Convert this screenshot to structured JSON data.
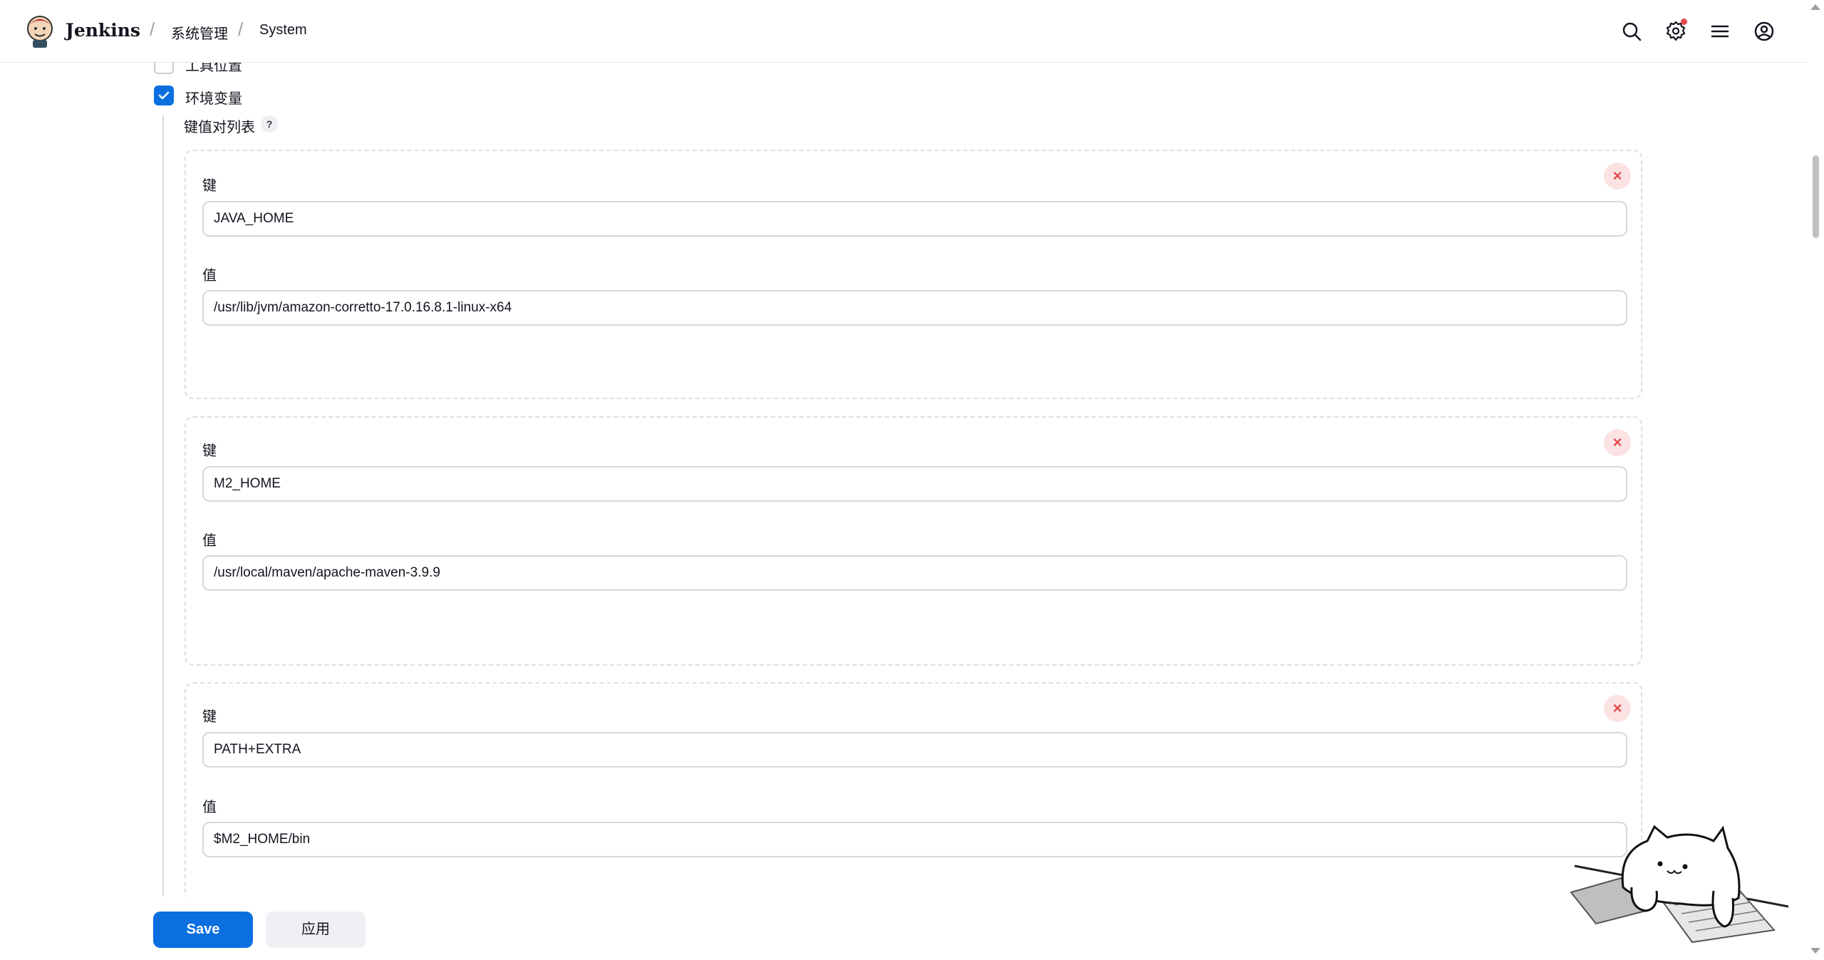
{
  "header": {
    "brand": "Jenkins",
    "breadcrumbs": [
      "系统管理",
      "System"
    ],
    "icons": [
      "search-icon",
      "settings-icon",
      "menu-icon",
      "user-icon"
    ],
    "notification_dot_color": "#e5484d"
  },
  "options": {
    "tool_locations_label": "工具位置",
    "tool_locations_checked": false,
    "env_vars_label": "环境变量",
    "env_vars_checked": true
  },
  "kv_list": {
    "label": "键值对列表",
    "help": "?",
    "key_label": "键",
    "value_label": "值",
    "entries": [
      {
        "key": "JAVA_HOME",
        "value": "/usr/lib/jvm/amazon-corretto-17.0.16.8.1-linux-x64"
      },
      {
        "key": "M2_HOME",
        "value": "/usr/local/maven/apache-maven-3.9.9"
      },
      {
        "key": "PATH+EXTRA",
        "value": "$M2_HOME/bin"
      }
    ],
    "remove_glyph": "×"
  },
  "footer": {
    "save_label": "Save",
    "apply_label": "应用"
  },
  "colors": {
    "primary": "#0b6fe0",
    "danger": "#e5484d"
  }
}
